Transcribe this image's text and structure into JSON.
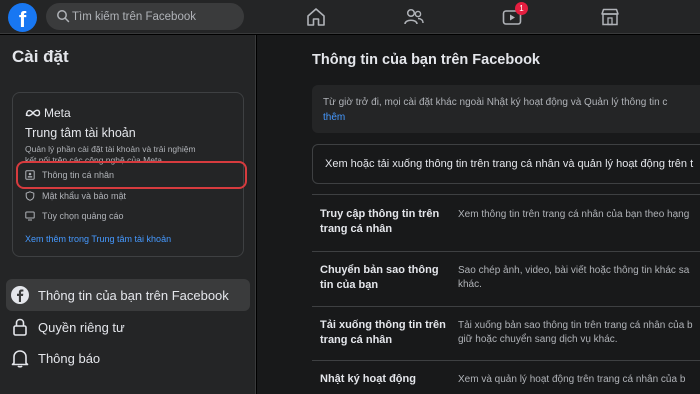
{
  "topbar": {
    "logo": "f",
    "search_placeholder": "Tìm kiếm trên Facebook",
    "nav_icons": [
      "home-icon",
      "friends-icon",
      "video-icon",
      "marketplace-icon"
    ],
    "video_badge": "1"
  },
  "sidebar": {
    "title": "Cài đặt",
    "accounts_center": {
      "brand": "Meta",
      "title": "Trung tâm tài khoản",
      "description": "Quản lý phần cài đặt tài khoản và trải nghiệm kết nối trên các công nghệ của Meta",
      "items": [
        {
          "label": "Thông tin cá nhân",
          "icon": "id-card-icon"
        },
        {
          "label": "Mật khẩu và bảo mật",
          "icon": "shield-icon"
        },
        {
          "label": "Tùy chọn quảng cáo",
          "icon": "monitor-icon"
        }
      ],
      "link": "Xem thêm trong Trung tâm tài khoản"
    },
    "nav": [
      {
        "label": "Thông tin của bạn trên Facebook",
        "icon": "facebook-icon",
        "active": true
      },
      {
        "label": "Quyền riêng tư",
        "icon": "lock-icon",
        "active": false
      },
      {
        "label": "Thông báo",
        "icon": "bell-icon",
        "active": false
      }
    ]
  },
  "main": {
    "title": "Thông tin của bạn trên Facebook",
    "info_text": "Từ giờ trở đi, mọi cài đặt khác ngoài Nhật ký hoạt động và Quản lý thông tin c",
    "info_link": "thêm",
    "view_box_text": "Xem hoặc tải xuống thông tin trên trang cá nhân và quản lý hoạt động trên t",
    "rows": [
      {
        "title": "Truy cập thông tin trên trang cá nhân",
        "desc": "Xem thông tin trên trang cá nhân của bạn theo hạng"
      },
      {
        "title": "Chuyển bản sao thông tin của bạn",
        "desc": "Sao chép ảnh, video, bài viết hoặc thông tin khác sa khác."
      },
      {
        "title": "Tải xuống thông tin trên trang cá nhân",
        "desc": "Tải xuống bản sao thông tin trên trang cá nhân của b giữ hoặc chuyển sang dịch vụ khác."
      },
      {
        "title": "Nhật ký hoạt động",
        "desc": "Xem và quản lý hoạt động trên trang cá nhân của b"
      }
    ]
  },
  "colors": {
    "accent": "#1877f2",
    "link": "#4599ff",
    "highlight": "#d73b3e",
    "badge": "#e41e3f"
  }
}
